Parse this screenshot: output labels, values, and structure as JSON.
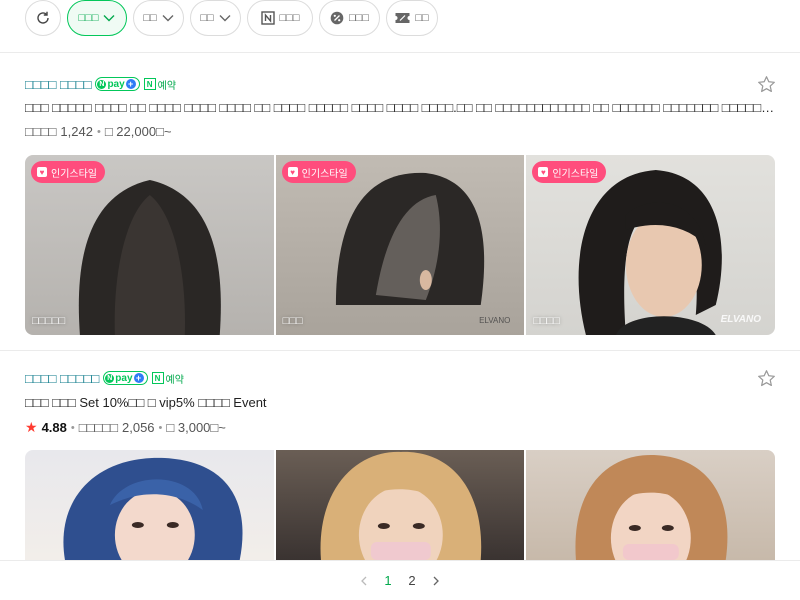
{
  "filters": {
    "refresh_icon": "refresh-icon",
    "chips": [
      {
        "label": "□□□",
        "active": true,
        "has_dropdown": true
      },
      {
        "label": "□□",
        "active": false,
        "has_dropdown": true
      },
      {
        "label": "□□",
        "active": false,
        "has_dropdown": true
      },
      {
        "label": "□□□",
        "active": false,
        "icon": "naver-n-icon"
      },
      {
        "label": "□□□",
        "active": false,
        "icon": "percent-icon"
      },
      {
        "label": "□□",
        "active": false,
        "icon": "coupon-icon"
      }
    ]
  },
  "listings": [
    {
      "name": "□□□□ □□□□",
      "npay_label": "pay",
      "booking_label": "예약",
      "description": "□□□ □□□□□ □□□□ □□ □□□□ □□□□ □□□□ □□ □□□□ □□□□□ □□□□ □□□□ □□□□.□□ □□ □□□□□□□□□□□□ □□ □□□□□□ □□□□□□□ □□□□□ □□□□□□□□.□□□ □□□ □□□□□□ □□□□ □□□□ □□□ □□ …",
      "review_label": "□□□□",
      "review_count": "1,242",
      "price": "□ 22,000□~",
      "photos": [
        {
          "badge": "인기스타일",
          "caption": "□□□□□"
        },
        {
          "badge": "인기스타일",
          "caption": "□□□",
          "watermark": "ELVANO"
        },
        {
          "badge": "인기스타일",
          "caption": "□□□□",
          "watermark": "ELVANO"
        }
      ]
    },
    {
      "name": "□□□□ □□□□□",
      "npay_label": "pay",
      "booking_label": "예약",
      "description": "□□□ □□□ Set 10%□□ □ vip5% □□□□ Event",
      "rating": "4.88",
      "review_label": "□□□□□",
      "review_count": "2,056",
      "price": "□ 3,000□~",
      "photos": [
        {
          "caption": ""
        },
        {
          "caption": ""
        },
        {
          "caption": ""
        }
      ]
    }
  ],
  "pagination": {
    "pages": [
      "1",
      "2"
    ],
    "current": "1"
  },
  "colors": {
    "accent": "#03c75a",
    "title": "#0b7a8a",
    "badge": "#ff4d7d",
    "rating_star": "#ff3b30"
  }
}
